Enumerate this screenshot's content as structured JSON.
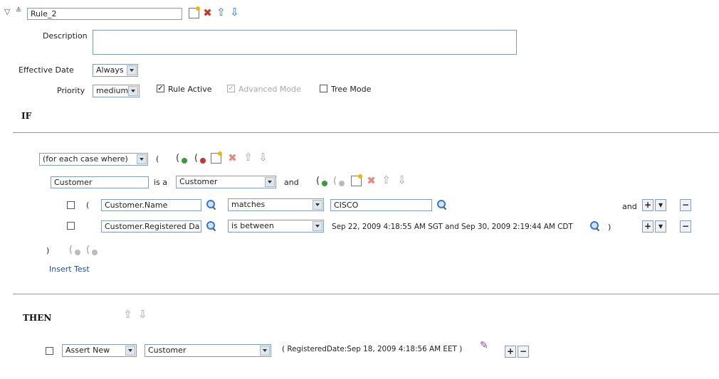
{
  "rule": {
    "name": "Rule_2",
    "description_label": "Description",
    "description_value": "",
    "effective_date_label": "Effective Date",
    "effective_date_value": "Always",
    "priority_label": "Priority",
    "priority_value": "medium",
    "rule_active_label": "Rule Active",
    "rule_active_checked": true,
    "advanced_mode_label": "Advanced Mode",
    "advanced_mode_checked": true,
    "tree_mode_label": "Tree Mode",
    "tree_mode_checked": false
  },
  "if_section": {
    "heading": "IF",
    "scope_select": "(for each case where)",
    "open_paren": "(",
    "var_name": "Customer",
    "is_a_label": "is a",
    "type_select": "Customer",
    "and_label": "and",
    "tests": [
      {
        "open_paren": "(",
        "left": "Customer.Name",
        "operator": "matches",
        "right": "CISCO",
        "close_paren": "",
        "connector": "and"
      },
      {
        "open_paren": "",
        "left": "Customer.Registered Da",
        "operator": "is between",
        "right_text": "Sep 22, 2009 4:18:55 AM SGT and Sep 30, 2009 2:19:44 AM CDT",
        "close_paren": ")",
        "connector": ""
      }
    ],
    "close_brace": ")",
    "insert_test_label": "Insert Test"
  },
  "then_section": {
    "heading": "THEN",
    "action_select": "Assert New",
    "target_select": "Customer",
    "detail": "( RegisteredDate:Sep 18, 2009 4:18:56 AM EET )"
  },
  "buttons": {
    "plus": "+",
    "minus": "−",
    "dropdown": "▾"
  },
  "icons": {
    "collapse": "triangle-down-icon",
    "move": "double-chevron-up-icon",
    "edit": "edit-document-icon",
    "delete": "delete-x-icon",
    "up": "arrow-up-icon",
    "down": "arrow-down-icon",
    "search": "magnifier-icon",
    "add_paren": "add-parenthesis-icon",
    "remove_paren": "remove-parenthesis-icon",
    "expression_builder": "expression-builder-icon"
  },
  "colors": {
    "border": "#7f9db9",
    "separator": "#9a9a9a",
    "link": "#1f4f9a"
  }
}
